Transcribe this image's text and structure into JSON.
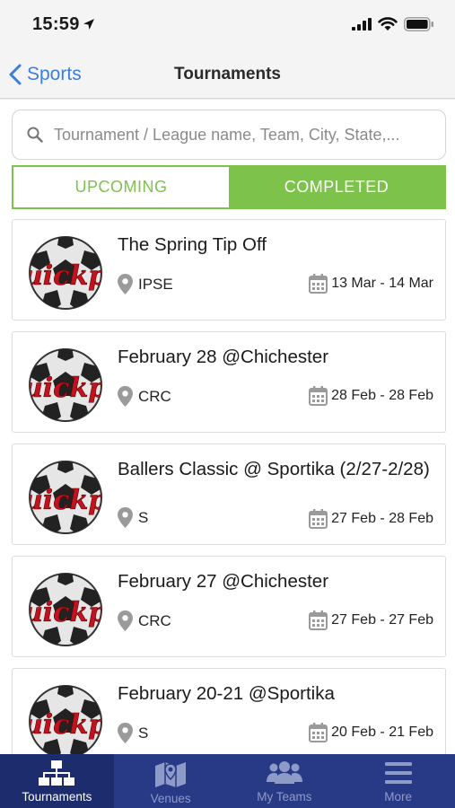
{
  "status_bar": {
    "time": "15:59"
  },
  "nav": {
    "back_label": "Sports",
    "title": "Tournaments"
  },
  "search": {
    "placeholder": "Tournament / League name, Team, City, State,..."
  },
  "segments": {
    "upcoming": "UPCOMING",
    "completed": "COMPLETED",
    "selected": "completed"
  },
  "tournaments": [
    {
      "title": "The Spring Tip Off",
      "location": "IPSE",
      "dates": "13 Mar - 14 Mar",
      "logo_text": "uickp"
    },
    {
      "title": "February 28 @Chichester",
      "location": "CRC",
      "dates": "28 Feb - 28 Feb",
      "logo_text": "uickp"
    },
    {
      "title": "Ballers Classic @ Sportika (2/27-2/28)",
      "location": "S",
      "dates": "27 Feb - 28 Feb",
      "logo_text": "uickp"
    },
    {
      "title": "February 27 @Chichester",
      "location": "CRC",
      "dates": "27 Feb - 27 Feb",
      "logo_text": "uickp"
    },
    {
      "title": "February 20-21 @Sportika",
      "location": "S",
      "dates": "20 Feb - 21 Feb",
      "logo_text": "uickp"
    }
  ],
  "tab_bar": {
    "items": [
      {
        "label": "Tournaments",
        "icon": "hierarchy-icon"
      },
      {
        "label": "Venues",
        "icon": "map-icon"
      },
      {
        "label": "My Teams",
        "icon": "group-icon"
      },
      {
        "label": "More",
        "icon": "menu-icon"
      }
    ],
    "selected": "Tournaments"
  },
  "colors": {
    "accent_green": "#7dc24a",
    "ios_blue": "#3a7ee0",
    "tab_bar_bg": "#283a85",
    "tab_selected_bg": "#1c2c6c",
    "tab_inactive": "#8e9ac8"
  }
}
